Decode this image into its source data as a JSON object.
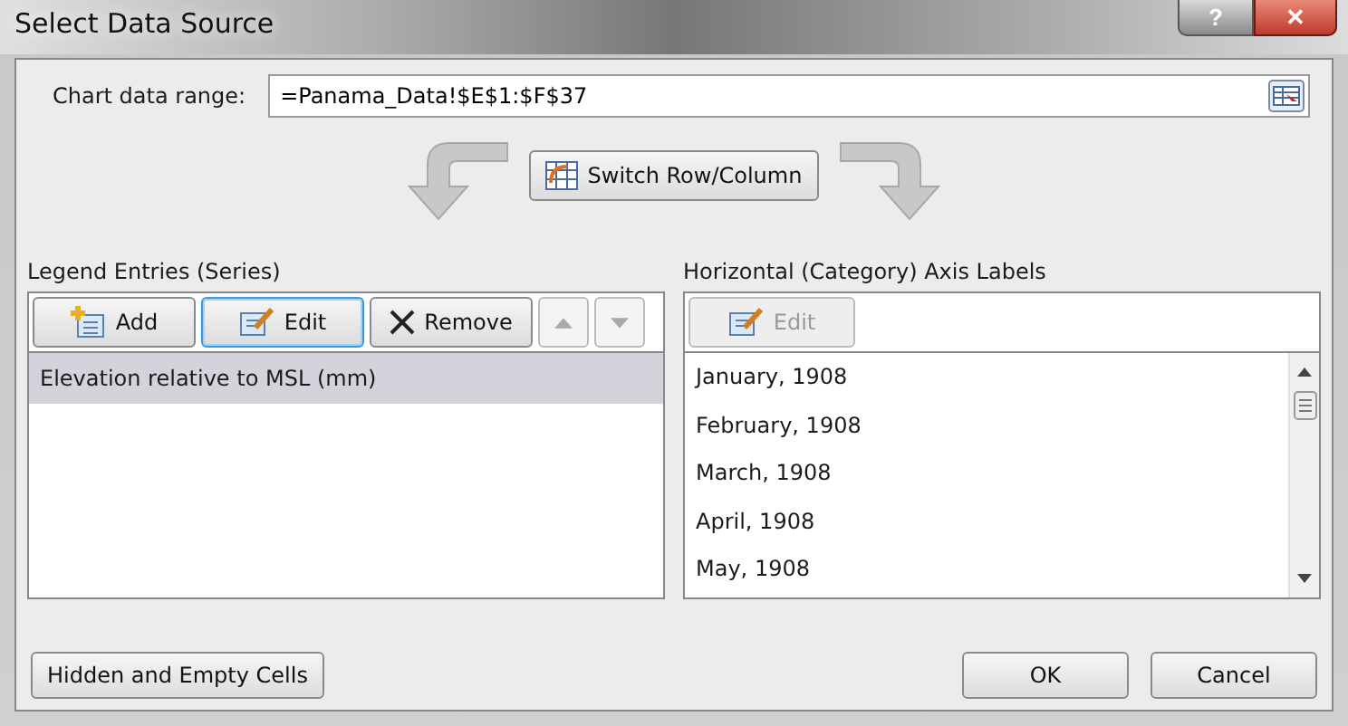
{
  "window": {
    "title": "Select Data Source",
    "help_button": "?",
    "close_button": "✕"
  },
  "chart_data_range": {
    "label": "Chart data range:",
    "value": "=Panama_Data!$E$1:$F$37"
  },
  "switch_button": "Switch Row/Column",
  "legend_entries": {
    "label": "Legend Entries (Series)",
    "buttons": [
      {
        "kind": "add",
        "label": "Add",
        "focused": false,
        "disabled": false
      },
      {
        "kind": "edit",
        "label": "Edit",
        "focused": true,
        "disabled": false
      },
      {
        "kind": "remove",
        "label": "Remove",
        "focused": false,
        "disabled": false
      },
      {
        "kind": "up",
        "focused": false,
        "disabled": true
      },
      {
        "kind": "down",
        "focused": false,
        "disabled": true
      }
    ],
    "items": [
      {
        "label": "Elevation relative to MSL (mm)",
        "selected": true
      }
    ]
  },
  "axis_labels": {
    "label": "Horizontal (Category) Axis Labels",
    "edit_button": {
      "label": "Edit",
      "disabled": true
    },
    "items": [
      {
        "label": "January, 1908",
        "selected": false
      },
      {
        "label": "February, 1908",
        "selected": false
      },
      {
        "label": "March, 1908",
        "selected": false
      },
      {
        "label": "April, 1908",
        "selected": false
      },
      {
        "label": "May, 1908",
        "selected": false
      }
    ]
  },
  "footer": {
    "hidden_cells_button": "Hidden and Empty Cells",
    "ok_button": "OK",
    "cancel_button": "Cancel"
  }
}
